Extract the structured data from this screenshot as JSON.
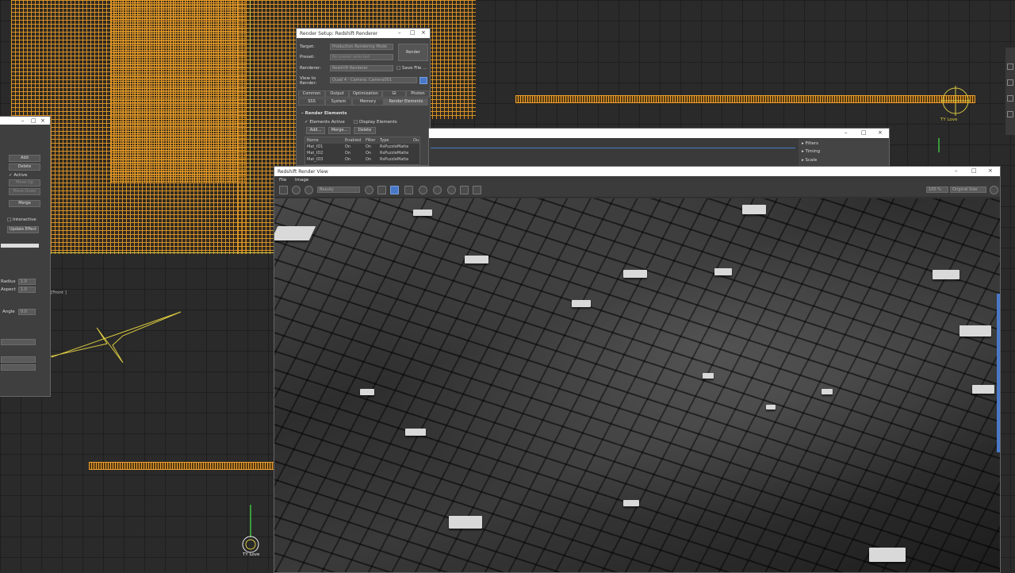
{
  "viewport": {
    "label": "[Front   ]",
    "gizmo_label": "TY Love"
  },
  "render_setup": {
    "title": "Render Setup: Redshift Renderer",
    "target_label": "Target:",
    "target_value": "Production Rendering Mode",
    "preset_label": "Preset:",
    "preset_value": "No preset selected",
    "renderer_label": "Renderer:",
    "renderer_value": "Redshift Renderer",
    "save_file_label": "Save File",
    "view_label": "View to Render:",
    "view_value": "Quad 4 - Camera: Camera001",
    "render_button": "Render",
    "tabs_row1": [
      "Common",
      "Output",
      "Optimization",
      "GI",
      "Photon"
    ],
    "tabs_row2": [
      "SSS",
      "System",
      "Memory",
      "Render Elements"
    ],
    "section_title": "Render Elements",
    "elements_active": "Elements Active",
    "display_elements": "Display Elements",
    "add_button": "Add...",
    "merge_button": "Merge...",
    "delete_button": "Delete",
    "columns": [
      "Name",
      "Enabled",
      "Filter",
      "Type",
      "Ou"
    ],
    "rows": [
      {
        "name": "Mat_ID1",
        "enabled": "On",
        "filter": "On",
        "type": "RsPuzzleMatte"
      },
      {
        "name": "Mat_ID2",
        "enabled": "On",
        "filter": "On",
        "type": "RsPuzzleMatte"
      },
      {
        "name": "Mat_ID3",
        "enabled": "On",
        "filter": "On",
        "type": "RsPuzzleMatte"
      }
    ]
  },
  "left_panel": {
    "add": "Add",
    "delete": "Delete",
    "active": "Active",
    "move_up": "Move Up",
    "move_down": "Move Down",
    "merge": "Merge",
    "interactive": "Interactive",
    "update_effect": "Update Effect",
    "radius_label": "Radius",
    "radius_value": "1.0",
    "aspect_label": "Aspect",
    "aspect_value": "1.0",
    "angle_label": "Angle",
    "angle_value": "0.0"
  },
  "back_window": {
    "rollouts": [
      "Filters",
      "Timing",
      "Scale"
    ]
  },
  "render_view": {
    "title": "Redshift Render View",
    "menu": [
      "File",
      "Image"
    ],
    "aov_value": "Beauty",
    "zoom_value": "100 %",
    "size_value": "Original Size"
  },
  "colors": {
    "wire_orange": "#f0a030",
    "spline_yellow": "#d9c840",
    "selection_blue": "#4a78c8"
  }
}
